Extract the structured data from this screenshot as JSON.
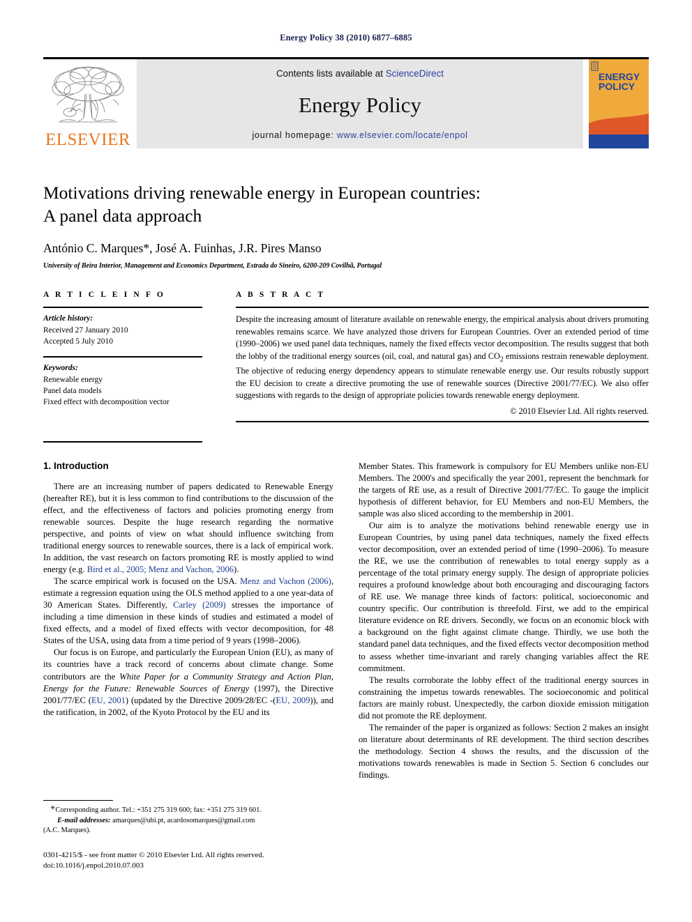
{
  "running_head": "Energy Policy 38 (2010) 6877–6885",
  "banner": {
    "publisher_wordmark": "ELSEVIER",
    "contents_prefix": "Contents lists available at ",
    "contents_link": "ScienceDirect",
    "journal_title": "Energy Policy",
    "homepage_prefix": "journal homepage: ",
    "homepage_url": "www.elsevier.com/locate/enpol",
    "cover_title_line1": "ENERGY",
    "cover_title_line2": "POLICY",
    "colors": {
      "elsevier_orange": "#E87722",
      "link_blue": "#2b3f9e",
      "banner_gray": "#e6e6e6",
      "cover_amber": "#F0A93B",
      "cover_red": "#E0572A",
      "cover_blue": "#21469B",
      "running_head_blue": "#1a2050",
      "citation_blue": "#1a3a8f"
    }
  },
  "article": {
    "title_line1": "Motivations driving renewable energy in European countries:",
    "title_line2": "A panel data approach",
    "authors": "António C. Marques*, José A. Fuinhas, J.R. Pires Manso",
    "affiliation": "University of Beira Interior, Management and Economics Department, Estrada do Sineiro, 6200-209 Covilhã, Portugal"
  },
  "article_info": {
    "heading": "A R T I C L E   I N F O",
    "history_label": "Article history:",
    "received": "Received 27 January 2010",
    "accepted": "Accepted 5 July 2010",
    "keywords_label": "Keywords:",
    "keywords": [
      "Renewable energy",
      "Panel data models",
      "Fixed effect with decomposition vector"
    ]
  },
  "abstract": {
    "heading": "A B S T R A C T",
    "text": "Despite the increasing amount of literature available on renewable energy, the empirical analysis about drivers promoting renewables remains scarce. We have analyzed those drivers for European Countries. Over an extended period of time (1990–2006) we used panel data techniques, namely the fixed effects vector decomposition. The results suggest that both the lobby of the traditional energy sources (oil, coal, and natural gas) and CO2 emissions restrain renewable deployment. The objective of reducing energy dependency appears to stimulate renewable energy use. Our results robustly support the EU decision to create a directive promoting the use of renewable sources (Directive 2001/77/EC). We also offer suggestions with regards to the design of appropriate policies towards renewable energy deployment.",
    "copyright": "© 2010 Elsevier Ltd. All rights reserved."
  },
  "body": {
    "section1_title": "1.  Introduction",
    "left_paragraphs": [
      "There are an increasing number of papers dedicated to Renewable Energy (hereafter RE), but it is less common to find contributions to the discussion of the effect, and the effectiveness of factors and policies promoting energy from renewable sources. Despite the huge research regarding the normative perspective, and points of view on what should influence switching from traditional energy sources to renewable sources, there is a lack of empirical work. In addition, the vast research on factors promoting RE is mostly applied to wind energy (e.g. Bird et al., 2005; Menz and Vachon, 2006).",
      "The scarce empirical work is focused on the USA. Menz and Vachon (2006), estimate a regression equation using the OLS method applied to a one year-data of 30 American States. Differently, Carley (2009) stresses the importance of including a time dimension in these kinds of studies and estimated a model of fixed effects, and a model of fixed effects with vector decomposition, for 48 States of the USA, using data from a time period of 9 years (1998–2006).",
      "Our focus is on Europe, and particularly the European Union (EU), as many of its countries have a track record of concerns about climate change. Some contributors are the White Paper for a Community Strategy and Action Plan, Energy for the Future: Renewable Sources of Energy (1997), the Directive 2001/77/EC (EU, 2001) (updated by the Directive 2009/28/EC -(EU, 2009)), and the ratification, in 2002, of the Kyoto Protocol by the EU and its"
    ],
    "right_paragraphs": [
      "Member States. This framework is compulsory for EU Members unlike non-EU Members. The 2000's and specifically the year 2001, represent the benchmark for the targets of RE use, as a result of Directive 2001/77/EC. To gauge the implicit hypothesis of different behavior, for EU Members and non-EU Members, the sample was also sliced according to the membership in 2001.",
      "Our aim is to analyze the motivations behind renewable energy use in European Countries, by using panel data techniques, namely the fixed effects vector decomposition, over an extended period of time (1990–2006). To measure the RE, we use the contribution of renewables to total energy supply as a percentage of the total primary energy supply. The design of appropriate policies requires a profound knowledge about both encouraging and discouraging factors of RE use. We manage three kinds of factors: political, socioeconomic and country specific. Our contribution is threefold. First, we add to the empirical literature evidence on RE drivers. Secondly, we focus on an economic block with a background on the fight against climate change. Thirdly, we use both the standard panel data techniques, and the fixed effects vector decomposition method to assess whether time-invariant and rarely changing variables affect the RE commitment.",
      "The results corroborate the lobby effect of the traditional energy sources in constraining the impetus towards renewables. The socioeconomic and political factors are mainly robust. Unexpectedly, the carbon dioxide emission mitigation did not promote the RE deployment.",
      "The remainder of the paper is organized as follows: Section 2 makes an insight on literature about determinants of RE development. The third section describes the methodology. Section 4 shows the results, and the discussion of the motivations towards renewables is made in Section 5. Section 6 concludes our findings."
    ]
  },
  "footnotes": {
    "corresponding": "Corresponding author. Tel.: +351 275 319 600; fax: +351 275 319 601.",
    "email_label": "E-mail addresses:",
    "emails": "amarques@ubi.pt, acardosomarques@gmail.com",
    "email_owner": "(A.C. Marques).",
    "issn_line": "0301-4215/$ - see front matter © 2010 Elsevier Ltd. All rights reserved.",
    "doi_line": "doi:10.1016/j.enpol.2010.07.003"
  }
}
